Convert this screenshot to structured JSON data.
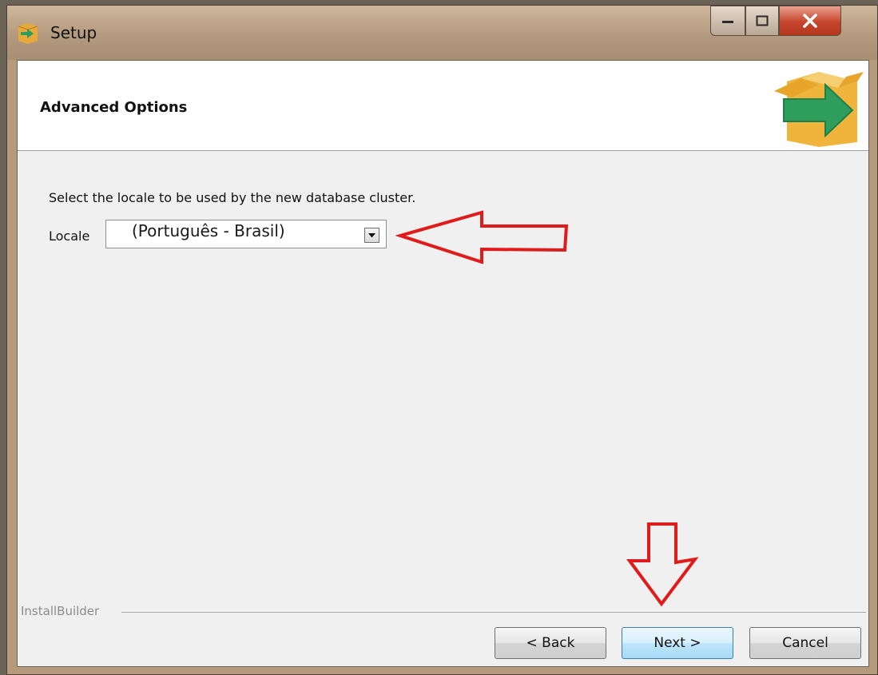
{
  "window": {
    "title": "Setup",
    "controls": {
      "minimize": "minimize",
      "maximize": "maximize",
      "close": "close"
    }
  },
  "header": {
    "title": "Advanced Options",
    "logo_icon": "installer-box-icon"
  },
  "content": {
    "prompt": "Select the locale to be used by the new database cluster.",
    "locale": {
      "label": "Locale",
      "selected": "(Português - Brasil)"
    }
  },
  "footer": {
    "brand": "InstallBuilder",
    "buttons": {
      "back": "< Back",
      "next": "Next >",
      "cancel": "Cancel"
    }
  },
  "annotations": {
    "color": "#e01b1b"
  },
  "colors": {
    "accent": "#3c7fb1",
    "close": "#c6452c",
    "logo_green": "#2f9e5c",
    "logo_box": "#f0b43c"
  }
}
